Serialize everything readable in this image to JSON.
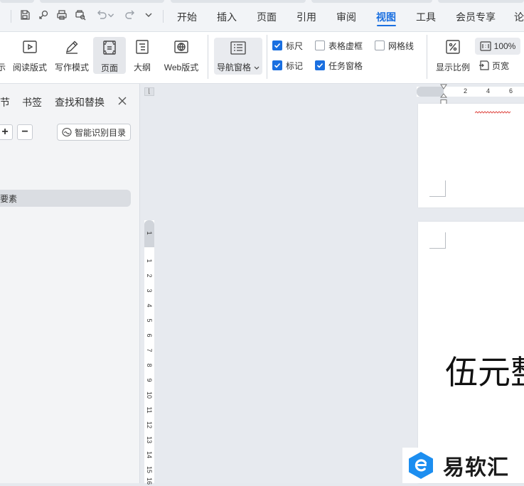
{
  "menubar": {
    "items": [
      "开始",
      "插入",
      "页面",
      "引用",
      "审阅",
      "视图",
      "工具",
      "会员专享",
      "论"
    ],
    "active": "视图"
  },
  "ribbon": {
    "buttons": {
      "show_partial": "示",
      "reading_mode": "阅读版式",
      "writing_mode": "写作模式",
      "page": "页面",
      "outline": "大纲",
      "web_layout": "Web版式",
      "nav_pane": "导航窗格"
    },
    "checkboxes": {
      "ruler": {
        "label": "标尺",
        "checked": true
      },
      "table_gridlines": {
        "label": "表格虚框",
        "checked": false
      },
      "gridlines": {
        "label": "网格线",
        "checked": false
      },
      "marks": {
        "label": "标记",
        "checked": true
      },
      "task_pane": {
        "label": "任务窗格",
        "checked": true
      }
    },
    "zoom": {
      "label": "显示比例",
      "value": "100%",
      "page_width": "页宽"
    }
  },
  "navpane": {
    "tabs": [
      "节",
      "书签",
      "查找和替换"
    ],
    "smart_toc": "智能识别目录",
    "toc_item": "要素"
  },
  "ruler": {
    "h_ticks": [
      "2",
      "4",
      "6"
    ],
    "v_ticks": [
      "1",
      "1",
      "2",
      "3",
      "4",
      "5",
      "6",
      "7",
      "8",
      "9",
      "10",
      "11",
      "12",
      "13",
      "14",
      "15",
      "16"
    ]
  },
  "document": {
    "text": "伍元整"
  },
  "watermark": {
    "text": "易软汇"
  },
  "colors": {
    "accent": "#1a6fe0",
    "logo_blue": "#1c8ef0"
  }
}
